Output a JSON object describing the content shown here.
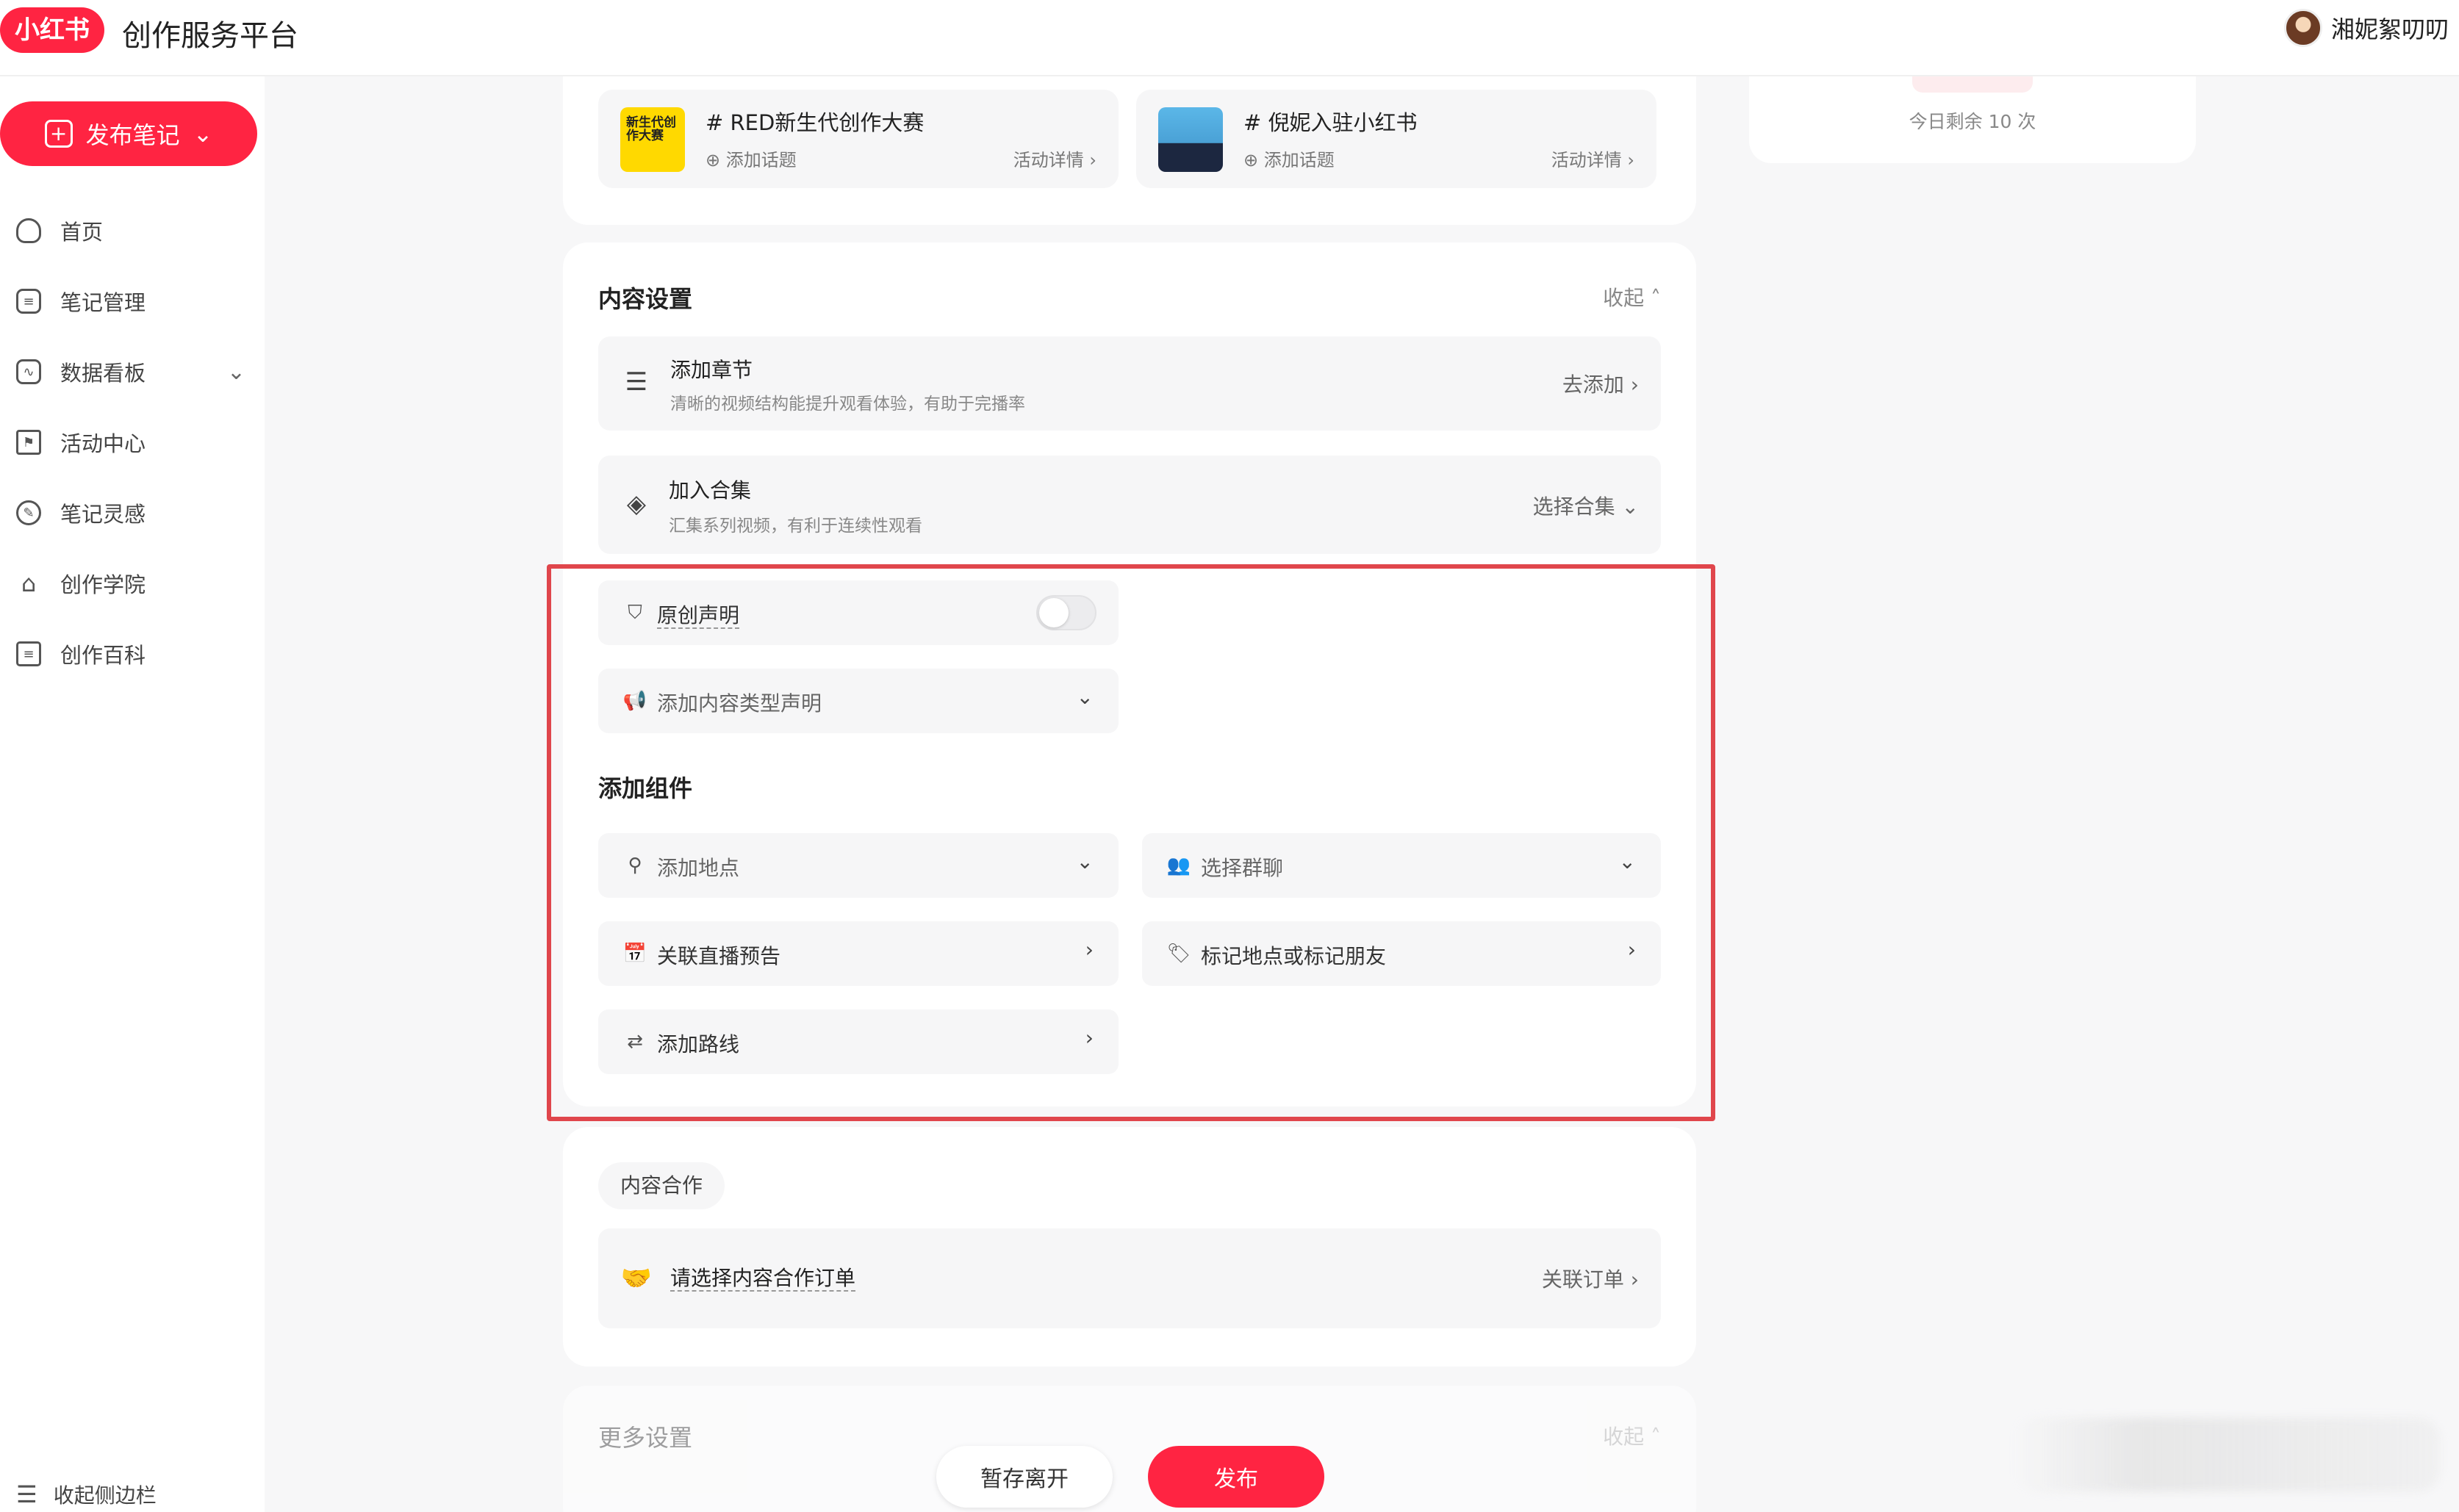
{
  "header": {
    "logo": "小红书",
    "app_title": "创作服务平台",
    "user_name": "湘妮絮叨叨"
  },
  "sidebar": {
    "publish_label": "发布笔记",
    "items": [
      {
        "label": "首页",
        "icon": "home-icon"
      },
      {
        "label": "笔记管理",
        "icon": "note-icon"
      },
      {
        "label": "数据看板",
        "icon": "chart-icon"
      },
      {
        "label": "活动中心",
        "icon": "flag-icon"
      },
      {
        "label": "笔记灵感",
        "icon": "bulb-icon"
      },
      {
        "label": "创作学院",
        "icon": "academy-icon"
      },
      {
        "label": "创作百科",
        "icon": "book-icon"
      }
    ],
    "collapse_label": "收起侧边栏"
  },
  "activities": [
    {
      "title": "# RED新生代创作大赛",
      "add_topic": "添加话题",
      "detail": "活动详情",
      "thumb_text": "新生代创作大赛"
    },
    {
      "title": "# 倪妮入驻小红书",
      "add_topic": "添加话题",
      "detail": "活动详情"
    }
  ],
  "content_settings": {
    "title": "内容设置",
    "collapse": "收起",
    "chapter": {
      "title": "添加章节",
      "desc": "清晰的视频结构能提升观看体验，有助于完播率",
      "action": "去添加"
    },
    "collection": {
      "title": "加入合集",
      "desc": "汇集系列视频，有利于连续性观看",
      "action": "选择合集"
    },
    "original_label": "原创声明",
    "original_on": false,
    "content_type_label": "添加内容类型声明",
    "components_title": "添加组件",
    "components": {
      "location": "添加地点",
      "group_chat": "选择群聊",
      "live_preview": "关联直播预告",
      "tag_friends": "标记地点或标记朋友",
      "route": "添加路线"
    }
  },
  "cooperation": {
    "tag": "内容合作",
    "order_label": "请选择内容合作订单",
    "order_action": "关联订单"
  },
  "more_settings": {
    "title": "更多设置",
    "collapse": "收起"
  },
  "right_panel": {
    "remaining": "今日剩余 10 次"
  },
  "footer": {
    "save_label": "暂存离开",
    "publish_label": "发布"
  }
}
